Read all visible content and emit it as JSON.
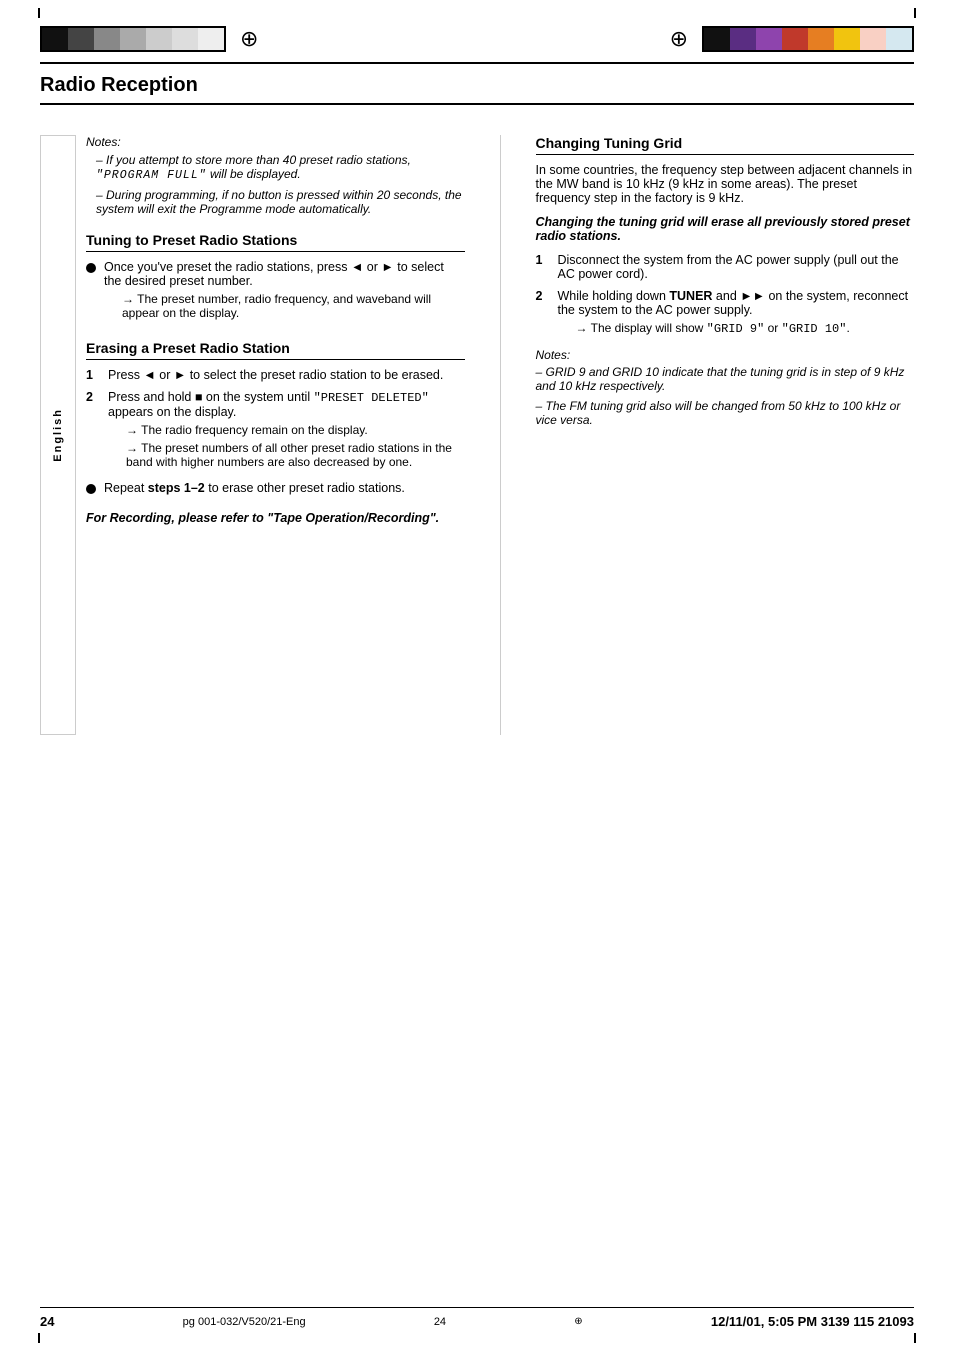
{
  "page": {
    "title": "Radio Reception",
    "number": "24",
    "footer_left": "pg 001-032/V520/21-Eng",
    "footer_center": "24",
    "footer_right": "12/11/01, 5:05 PM 3139 115 21093",
    "language_label": "English"
  },
  "top_bars": {
    "compass_symbol": "⊕"
  },
  "notes": {
    "label": "Notes:",
    "items": [
      "If you attempt to store more than 40 preset radio stations, \"PROGRAM FULL\" will be displayed.",
      "During programming, if no button is pressed within 20 seconds, the system will exit the Programme mode automatically."
    ]
  },
  "section_tuning": {
    "heading": "Tuning to Preset Radio Stations",
    "bullet1_text": "Once you've preset the radio stations, press",
    "bullet1_icons": "◄◄ or ►► to select the desired preset number.",
    "bullet1_arrow": "The preset number, radio frequency, and waveband will appear on the display."
  },
  "section_erasing": {
    "heading": "Erasing a Preset Radio Station",
    "step1": "Press ◄◄ or ►► to select the preset radio station to be erased.",
    "step2_a": "Press and hold ■ on the system until",
    "step2_code": "\"PRESET DELETED\"",
    "step2_b": "appears on the display.",
    "step2_arrow1": "The radio frequency remain on the display.",
    "step2_arrow2": "The preset numbers of all other preset radio stations in the band with higher numbers are also decreased by one.",
    "bullet_repeat": "Repeat",
    "bullet_repeat_bold": "steps 1–2",
    "bullet_repeat_end": "to erase other preset radio stations.",
    "recording_note": "For Recording, please refer to \"Tape Operation/Recording\"."
  },
  "section_grid": {
    "heading": "Changing Tuning Grid",
    "intro": "In some countries, the frequency step between adjacent channels in the MW band is 10 kHz (9 kHz in some areas). The preset frequency step in the factory is 9 kHz.",
    "warning_bold": "Changing the tuning grid will erase all previously stored preset radio stations.",
    "step1": "Disconnect the system from the AC power supply (pull out the AC power cord).",
    "step2_a": "While holding down",
    "step2_tuner": "TUNER",
    "step2_b": "and ►► on the system, reconnect the system to the AC power supply.",
    "step2_arrow_a": "The display will show",
    "step2_display1": "\"GRID 9\"",
    "step2_display_or": "or",
    "step2_display2": "\"GRID 10\"",
    "step2_display_end": ".",
    "notes_label": "Notes:",
    "notes": [
      "GRID 9 and GRID 10 indicate that the tuning grid is in step of 9 kHz and 10 kHz respectively.",
      "The FM tuning grid also will be changed from 50 kHz to 100 kHz or vice versa."
    ]
  }
}
